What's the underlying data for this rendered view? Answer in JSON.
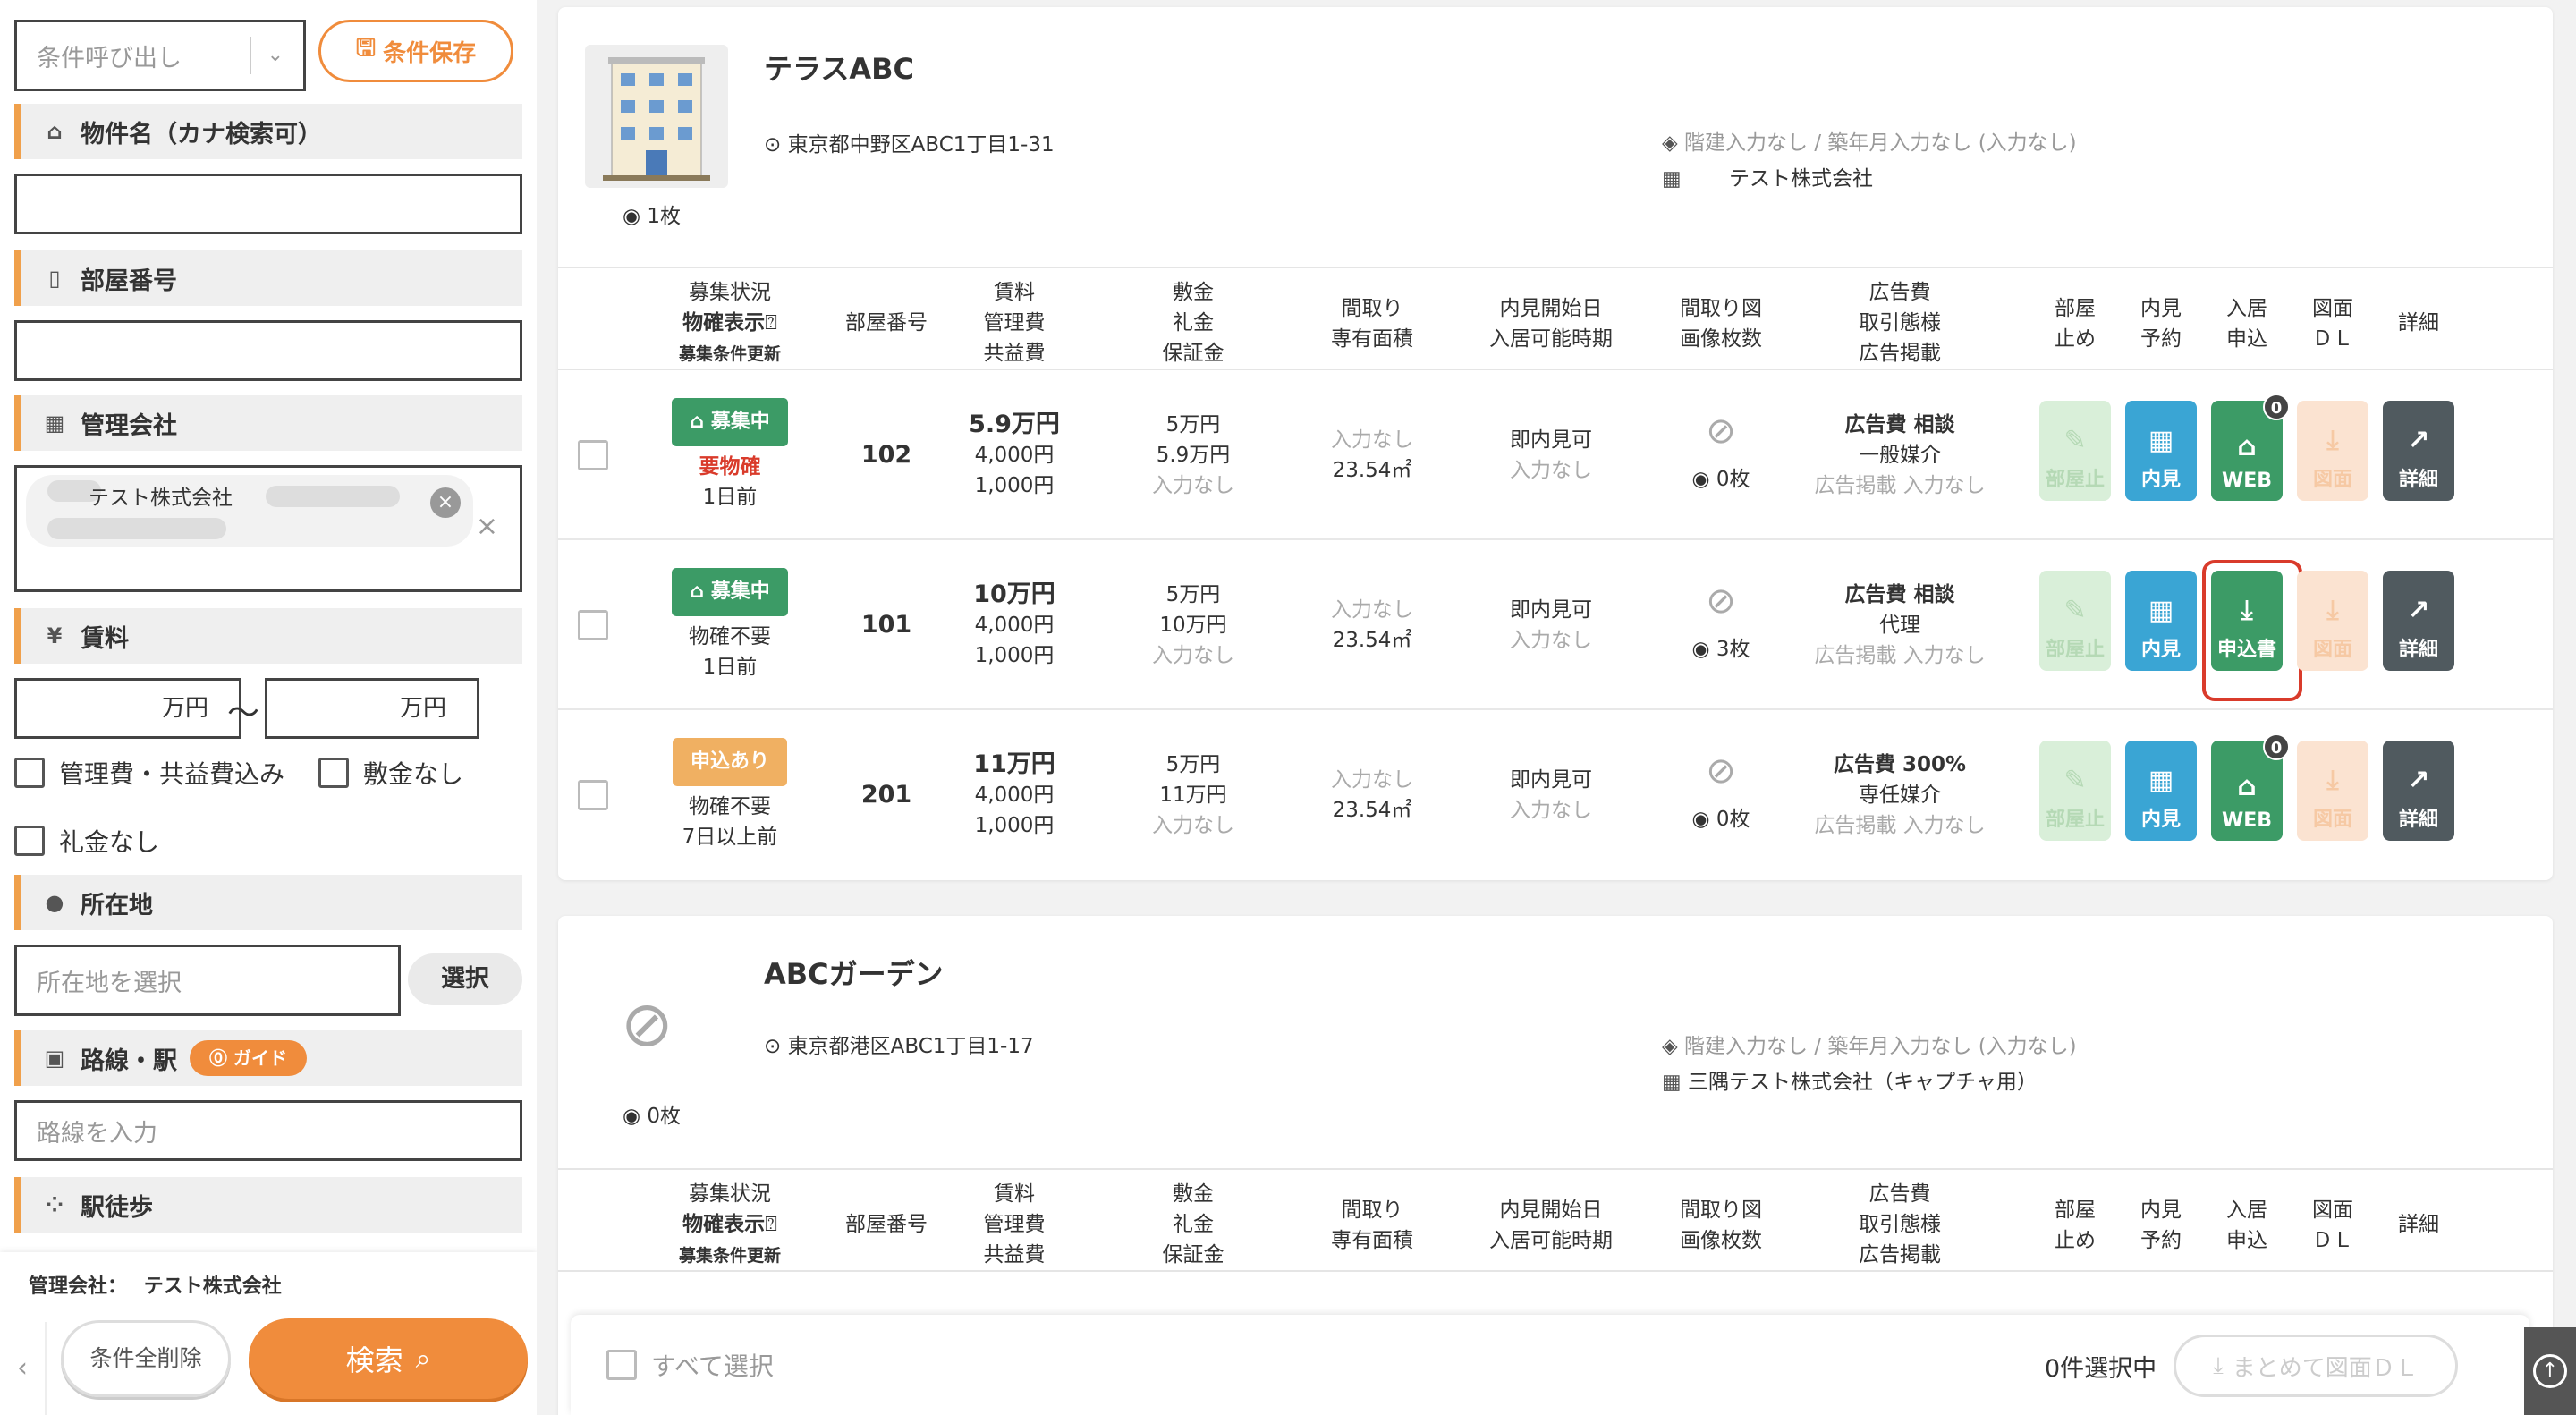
{
  "sidebar": {
    "cond_call_placeholder": "条件呼び出し",
    "cond_save": "条件保存",
    "prop_name_label": "物件名（カナ検索可）",
    "room_no_label": "部屋番号",
    "mgmt_label": "管理会社",
    "mgmt_chip": "テスト株式会社",
    "rent_label": "賃料",
    "rent_unit": "万円",
    "rent_sep": "〜",
    "opt_mgmt_fee": "管理費・共益費込み",
    "opt_no_deposit": "敷金なし",
    "opt_no_key": "礼金なし",
    "location_label": "所在地",
    "location_placeholder": "所在地を選択",
    "location_select": "選択",
    "route_label": "路線・駅",
    "guide": "ガイド",
    "route_placeholder": "路線を入力",
    "walk_label": "駅徒歩",
    "mgmt_summary": "管理会社：",
    "mgmt_summary_value": "テスト株式会社",
    "clear_all": "条件全削除",
    "search": "検索"
  },
  "table_header": {
    "status": [
      "募集状況",
      "物確表示",
      "募集条件更新"
    ],
    "room_no": "部屋番号",
    "rent": [
      "賃料",
      "管理費",
      "共益費"
    ],
    "deposit": [
      "敷金",
      "礼金",
      "保証金"
    ],
    "layout": [
      "間取り",
      "専有面積"
    ],
    "viewing": [
      "内見開始日",
      "入居可能時期"
    ],
    "floorplan": [
      "間取り図",
      "画像枚数"
    ],
    "ad": [
      "広告費",
      "取引態様",
      "広告掲載"
    ],
    "stop": [
      "部屋",
      "止め"
    ],
    "reserve": [
      "内見",
      "予約"
    ],
    "apply": [
      "入居",
      "申込"
    ],
    "dl": [
      "図面",
      "ＤＬ"
    ],
    "detail": "詳細"
  },
  "properties": [
    {
      "name": "テラスABC",
      "address": "東京都中野区ABC1丁目1-31",
      "photos": "1枚",
      "floors": "階建入力なし / 築年月入力なし (入力なし)",
      "company": "テスト株式会社",
      "rooms": [
        {
          "status": "募集中",
          "confirm": "要物確",
          "updated": "1日前",
          "room": "102",
          "rent": "5.9万円",
          "fee1": "4,000円",
          "fee2": "1,000円",
          "deposit": "5万円",
          "key": "5.9万円",
          "guarantee": "入力なし",
          "layout": "入力なし",
          "area": "23.54㎡",
          "view_start": "即内見可",
          "move_in": "入力なし",
          "imgs": "0枚",
          "ad": "広告費 相談",
          "deal": "一般媒介",
          "ad_post": "広告掲載 入力なし",
          "apply_label": "WEB",
          "apply_count": "0"
        },
        {
          "status": "募集中",
          "confirm": "物確不要",
          "updated": "1日前",
          "room": "101",
          "rent": "10万円",
          "fee1": "4,000円",
          "fee2": "1,000円",
          "deposit": "5万円",
          "key": "10万円",
          "guarantee": "入力なし",
          "layout": "入力なし",
          "area": "23.54㎡",
          "view_start": "即内見可",
          "move_in": "入力なし",
          "imgs": "3枚",
          "ad": "広告費 相談",
          "deal": "代理",
          "ad_post": "広告掲載 入力なし",
          "apply_label": "申込書",
          "apply_count": ""
        },
        {
          "status": "申込あり",
          "confirm": "物確不要",
          "updated": "7日以上前",
          "room": "201",
          "rent": "11万円",
          "fee1": "4,000円",
          "fee2": "1,000円",
          "deposit": "5万円",
          "key": "11万円",
          "guarantee": "入力なし",
          "layout": "入力なし",
          "area": "23.54㎡",
          "view_start": "即内見可",
          "move_in": "入力なし",
          "imgs": "0枚",
          "ad": "広告費 300%",
          "deal": "専任媒介",
          "ad_post": "広告掲載 入力なし",
          "apply_label": "WEB",
          "apply_count": "0"
        }
      ]
    },
    {
      "name": "ABCガーデン",
      "address": "東京都港区ABC1丁目1-17",
      "photos": "0枚",
      "floors": "階建入力なし / 築年月入力なし (入力なし)",
      "company": "三隅テスト株式会社（キャプチャ用）"
    }
  ],
  "btn": {
    "stop": "部屋止",
    "reserve": "内見",
    "dl": "図面",
    "detail": "詳細"
  },
  "footer": {
    "select_all": "すべて選択",
    "selected": "0件選択中",
    "bulk_dl": "まとめて図面ＤＬ"
  },
  "colors": {
    "accent": "#f08c3c",
    "green": "#3c9b66",
    "blue": "#3aa5d4",
    "red": "#d93b2b"
  }
}
